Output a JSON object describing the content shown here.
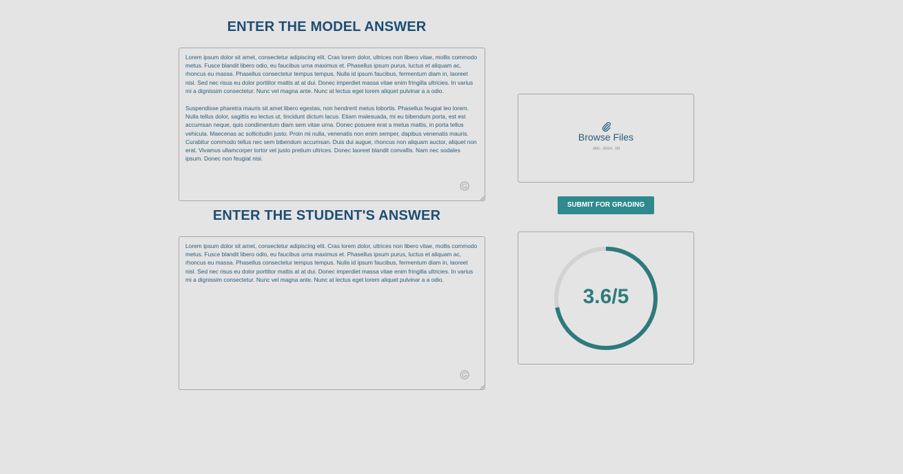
{
  "model_section": {
    "heading": "ENTER THE MODEL ANSWER",
    "paragraphs": [
      "Lorem ipsum dolor sit amet, consectetur adipiscing elit. Cras lorem dolor, ultrices non libero vitae, mollis commodo metus. Fusce blandit libero odio, eu faucibus urna maximus et. Phasellus ipsum purus, luctus et aliquam ac, rhoncus eu massa. Phasellus consectetur tempus tempus. Nulla id ipsum faucibus, fermentum diam in, laoreet nisl. Sed nec risus eu dolor porttitor mattis at at dui. Donec imperdiet massa vitae enim fringilla ultricies. In varius mi a dignissim consectetur. Nunc vel magna ante. Nunc at lectus eget lorem aliquet pulvinar a a odio.",
      "Suspendisse pharetra mauris sit amet libero egestas, non hendrerit metus lobortis. Phasellus feugiat leo lorem. Nulla tellus dolor, sagittis eu lectus ut, tincidunt dictum lacus. Etiam malesuada, mi eu bibendum porta, est est accumsan neque, quis condimentum diam sem vitae urna. Donec posuere erat a metus mattis, in porta tellus vehicula. Maecenas ac sollicitudin justo. Proin mi nulla, venenatis non enim semper, dapibus venenatis mauris. Curabitur commodo tellus nec sem bibendum accumsan. Duis dui augue, rhoncus non aliquam auctor, aliquet non erat. Vivamus ullamcorper tortor vel justo pretium ultrices. Donec laoreet blandit convallis. Nam nec sodales ipsum. Donec non feugiat nisi."
    ]
  },
  "student_section": {
    "heading": "ENTER THE STUDENT'S ANSWER",
    "paragraphs": [
      "Lorem ipsum dolor sit amet, consectetur adipiscing elit. Cras lorem dolor, ultrices non libero vitae, mollis commodo metus. Fusce blandit libero odio, eu faucibus urna maximus et. Phasellus ipsum purus, luctus et aliquam ac, rhoncus eu massa. Phasellus consectetur tempus tempus. Nulla id ipsum faucibus, fermentum diam in, laoreet nisl. Sed nec risus eu dolor porttitor mattis at at dui. Donec imperdiet massa vitae enim fringilla ultricies. In varius mi a dignissim consectetur. Nunc vel magna ante. Nunc at lectus eget lorem aliquet pulvinar a a odio."
    ]
  },
  "upload": {
    "icon": "paperclip-icon",
    "label": "Browse Files",
    "accepted_types": ".doc, .docx, .txt"
  },
  "submit": {
    "label": "SUBMIT FOR GRADING"
  },
  "score": {
    "display": "3.6/5",
    "value": 3.6,
    "max": 5
  },
  "colors": {
    "background": "#e4e4e4",
    "heading": "#1d4e73",
    "body_text": "#2a5b7a",
    "accent": "#2e8a8e",
    "score_ring": "#2e7a7d",
    "ring_track": "#d2d2d2"
  }
}
